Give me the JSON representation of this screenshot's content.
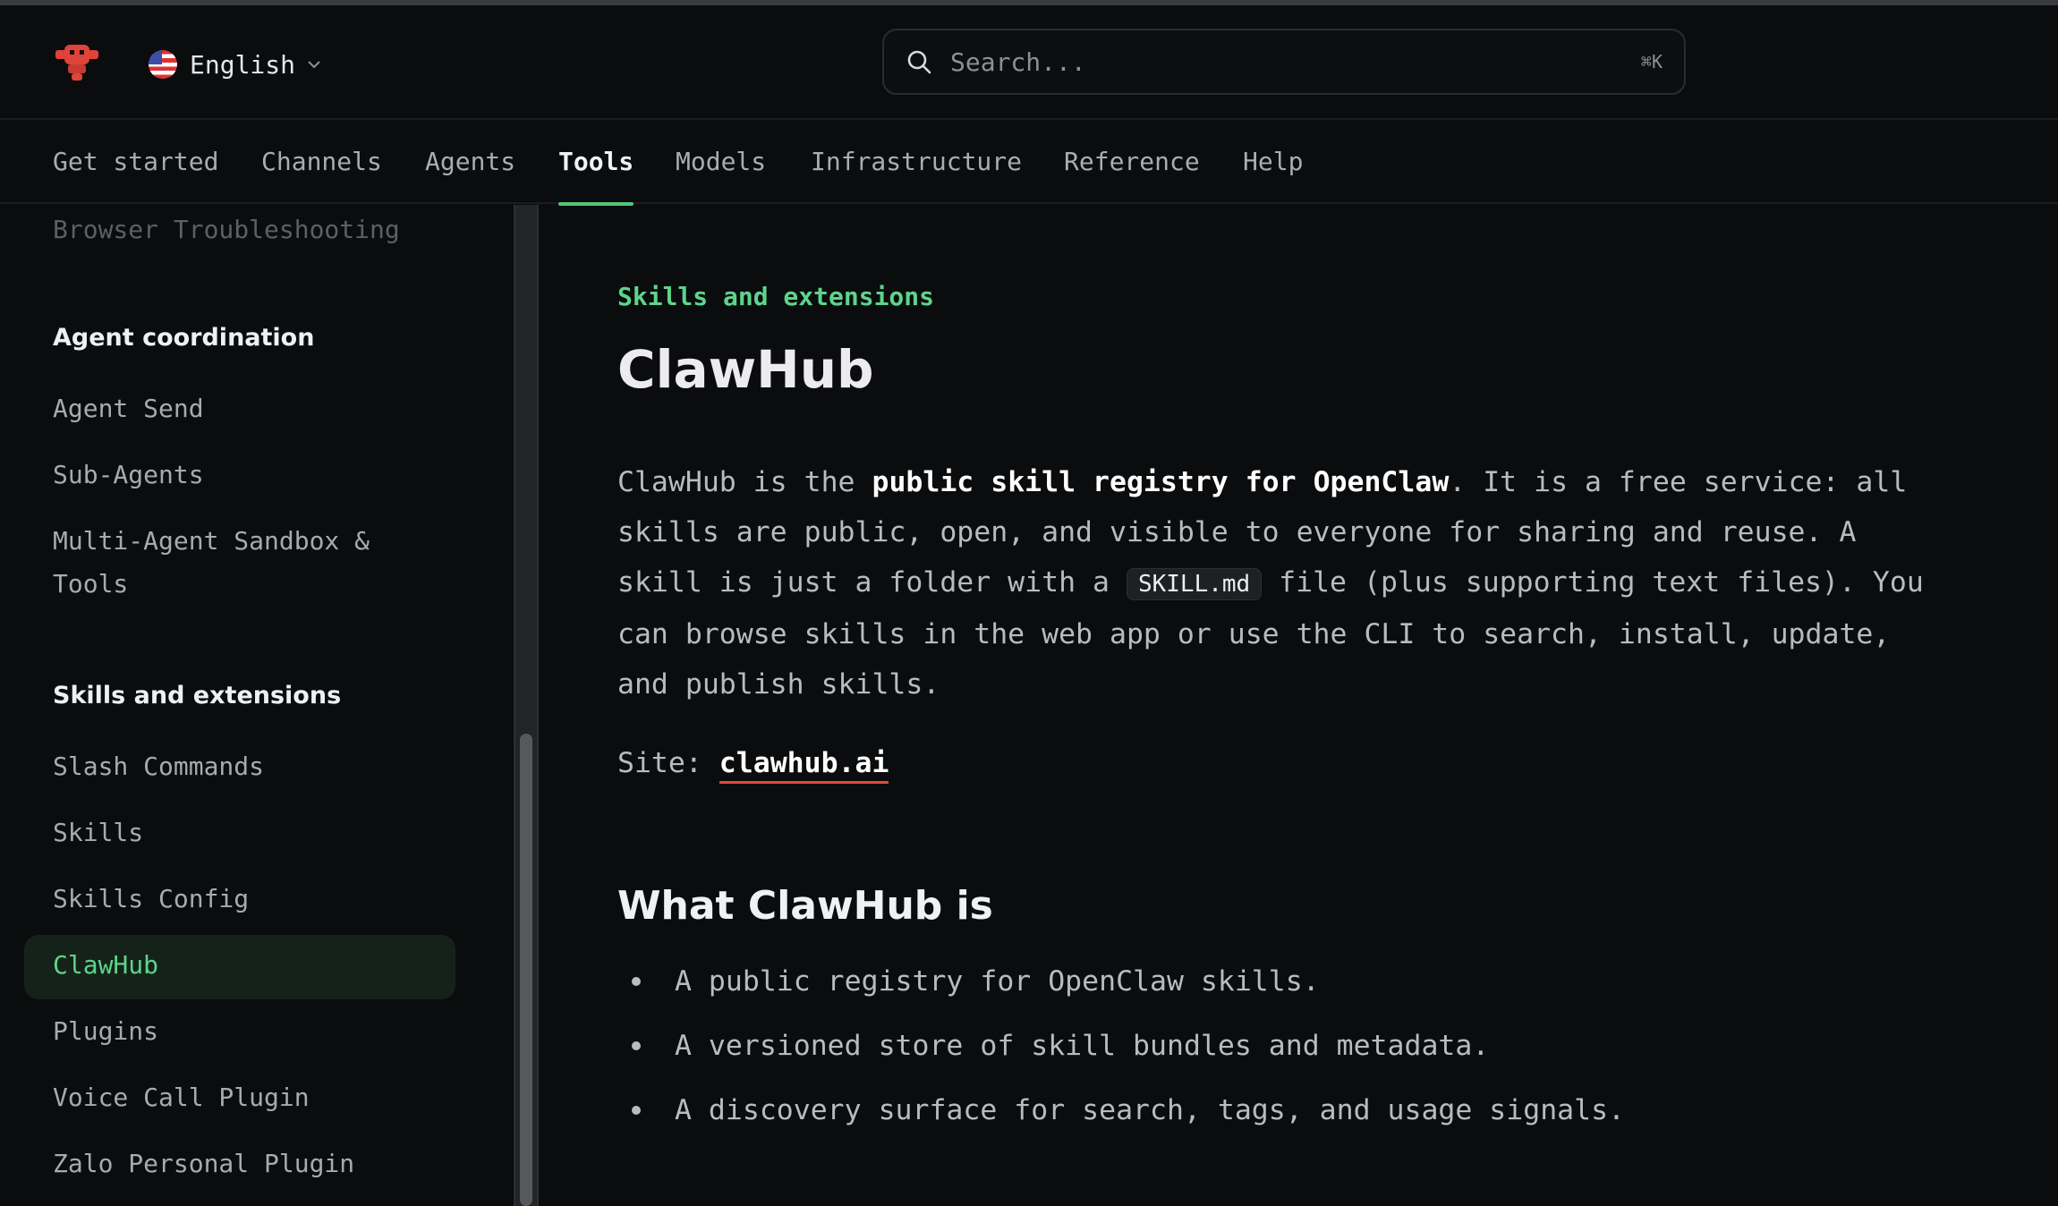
{
  "header": {
    "language": "English",
    "search_placeholder": "Search...",
    "search_shortcut": "⌘K"
  },
  "nav": {
    "items": [
      "Get started",
      "Channels",
      "Agents",
      "Tools",
      "Models",
      "Infrastructure",
      "Reference",
      "Help"
    ],
    "active": "Tools"
  },
  "sidebar": {
    "faded_item": "Browser Troubleshooting",
    "group1_heading": "Agent coordination",
    "group1_items": [
      "Agent Send",
      "Sub-Agents",
      "Multi-Agent Sandbox &",
      "Tools"
    ],
    "group2_heading": "Skills and extensions",
    "group2_items": [
      "Slash Commands",
      "Skills",
      "Skills Config",
      "ClawHub",
      "Plugins",
      "Voice Call Plugin",
      "Zalo Personal Plugin"
    ],
    "active": "ClawHub"
  },
  "content": {
    "eyebrow": "Skills and extensions",
    "title": "ClawHub",
    "intro_1": "ClawHub is the ",
    "intro_bold": "public skill registry for OpenClaw",
    "intro_2": ". It is a free service: all skills are public, open, and visible to everyone for sharing and reuse. A skill is just a folder with a ",
    "intro_code": "SKILL.md",
    "intro_3": " file (plus supporting text files). You can browse skills in the web app or use the CLI to search, install, update, and publish skills.",
    "site_label": "Site: ",
    "site_link": "clawhub.ai",
    "section_title": "What ClawHub is",
    "bullets": [
      "A public registry for OpenClaw skills.",
      "A versioned store of skill bundles and metadata.",
      "A discovery surface for search, tags, and usage signals."
    ]
  },
  "colors": {
    "accent": "#5dd48a",
    "link_underline": "#e24a3a",
    "background": "#0b0c0e"
  }
}
